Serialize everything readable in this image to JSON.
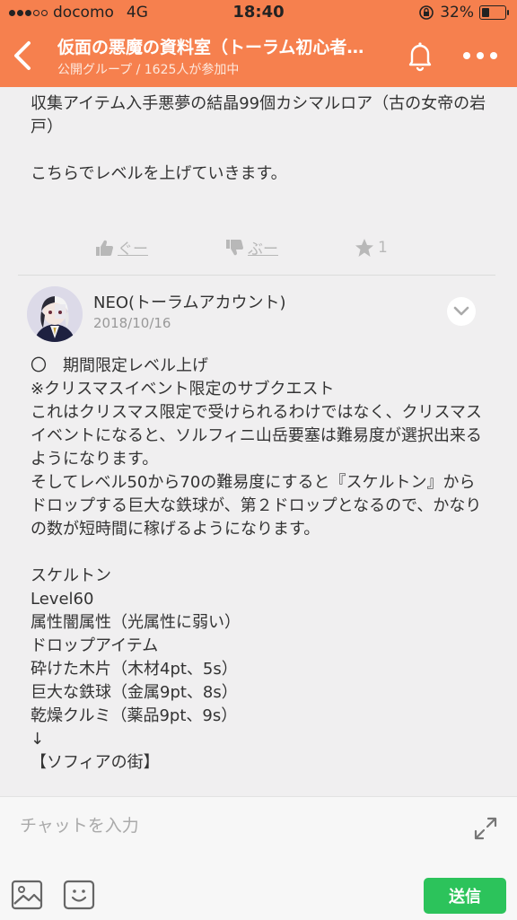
{
  "status_bar": {
    "carrier": "docomo",
    "network": "4G",
    "time": "18:40",
    "battery": "32%",
    "battery_level": 0.32
  },
  "header": {
    "title": "仮面の悪魔の資料室（トーラム初心者…",
    "subtitle": "公開グループ / 1625人が参加中",
    "color": "#f6804e"
  },
  "posts": [
    {
      "body": "収集アイテム入手悪夢の結晶99個カシマルロア（古の女帝の岩戸）\n\nこちらでレベルを上げていきます。",
      "reactions": {
        "good_label": "ぐー",
        "bad_label": "ぶー",
        "star_count": "1"
      }
    },
    {
      "author": "NEO(トーラムアカウント)",
      "date": "2018/10/16",
      "body": "〇　期間限定レベル上げ\n※クリスマスイベント限定のサブクエスト\nこれはクリスマス限定で受けられるわけではなく、クリスマスイベントになると、ソルフィニ山岳要塞は難易度が選択出来るようになります。\nそしてレベル50から70の難易度にすると『スケルトン』からドロップする巨大な鉄球が、第２ドロップとなるので、かなりの数が短時間に稼げるようになります。\n\nスケルトン\nLevel60\n属性闇属性（光属性に弱い）\nドロップアイテム\n砕けた木片（木材4pt、5s）\n巨大な鉄球（金属9pt、8s）\n乾燥クルミ（薬品9pt、9s）\n↓\n【ソフィアの街】"
    }
  ],
  "input_bar": {
    "placeholder": "チャットを入力",
    "send_label": "送信",
    "send_color": "#2cc35b"
  },
  "icons": [
    "back-icon",
    "bell-icon",
    "more-icon",
    "thumbs-up-icon",
    "thumbs-down-icon",
    "star-icon",
    "chevron-down-icon",
    "expand-icon",
    "image-icon",
    "emoji-icon"
  ]
}
